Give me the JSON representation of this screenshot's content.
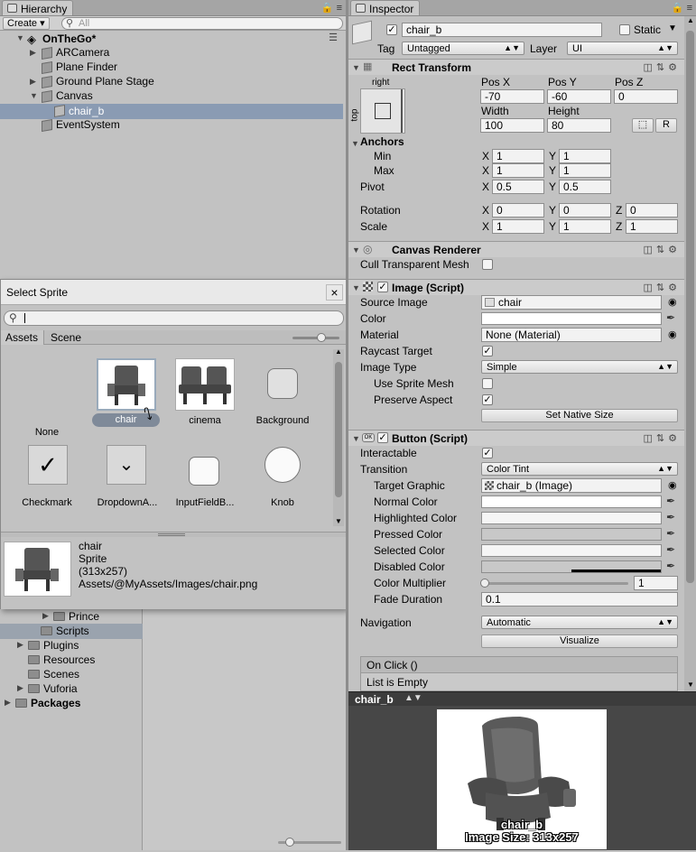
{
  "hierarchy": {
    "tab_label": "Hierarchy",
    "create_label": "Create",
    "search_placeholder": "All",
    "scene_name": "OnTheGo*",
    "items": [
      {
        "label": "ARCamera"
      },
      {
        "label": "Plane Finder"
      },
      {
        "label": "Ground Plane Stage"
      },
      {
        "label": "Canvas"
      },
      {
        "label": "chair_b"
      },
      {
        "label": "EventSystem"
      }
    ]
  },
  "project": {
    "items": [
      {
        "label": "Prince"
      },
      {
        "label": "Scripts"
      },
      {
        "label": "Plugins"
      },
      {
        "label": "Resources"
      },
      {
        "label": "Scenes"
      },
      {
        "label": "Vuforia"
      },
      {
        "label": "Packages"
      }
    ]
  },
  "select_sprite": {
    "title": "Select Sprite",
    "close_label": "×",
    "tabs": [
      "Assets",
      "Scene"
    ],
    "items": [
      {
        "label": "None"
      },
      {
        "label": "chair"
      },
      {
        "label": "cinema"
      },
      {
        "label": "Background"
      },
      {
        "label": "Checkmark"
      },
      {
        "label": "DropdownA..."
      },
      {
        "label": "InputFieldB..."
      },
      {
        "label": "Knob"
      }
    ],
    "info": {
      "name": "chair",
      "type": "Sprite",
      "size": "(313x257)",
      "path": "Assets/@MyAssets/Images/chair.png"
    }
  },
  "inspector": {
    "tab_label": "Inspector",
    "object_name": "chair_b",
    "static_label": "Static",
    "tag_label": "Tag",
    "tag_value": "Untagged",
    "layer_label": "Layer",
    "layer_value": "UI",
    "rect_transform": {
      "title": "Rect Transform",
      "anchor_h": "right",
      "anchor_v": "top",
      "pos_x_label": "Pos X",
      "pos_y_label": "Pos Y",
      "pos_z_label": "Pos Z",
      "pos_x": "-70",
      "pos_y": "-60",
      "pos_z": "0",
      "width_label": "Width",
      "height_label": "Height",
      "width": "100",
      "height": "80",
      "r_label": "R",
      "anchors_label": "Anchors",
      "min_label": "Min",
      "max_label": "Max",
      "min_x": "1",
      "min_y": "1",
      "max_x": "1",
      "max_y": "1",
      "pivot_label": "Pivot",
      "pivot_x": "0.5",
      "pivot_y": "0.5",
      "rotation_label": "Rotation",
      "rot_x": "0",
      "rot_y": "0",
      "rot_z": "0",
      "scale_label": "Scale",
      "scale_x": "1",
      "scale_y": "1",
      "scale_z": "1",
      "x": "X",
      "y": "Y",
      "z": "Z"
    },
    "canvas_renderer": {
      "title": "Canvas Renderer",
      "cull_label": "Cull Transparent Mesh"
    },
    "image": {
      "title": "Image (Script)",
      "source_label": "Source Image",
      "source_value": "chair",
      "color_label": "Color",
      "material_label": "Material",
      "material_value": "None (Material)",
      "raycast_label": "Raycast Target",
      "image_type_label": "Image Type",
      "image_type_value": "Simple",
      "sprite_mesh_label": "Use Sprite Mesh",
      "preserve_label": "Preserve Aspect",
      "native_size_label": "Set Native Size"
    },
    "button": {
      "title": "Button (Script)",
      "interactable_label": "Interactable",
      "transition_label": "Transition",
      "transition_value": "Color Tint",
      "target_label": "Target Graphic",
      "target_value": "chair_b (Image)",
      "normal_label": "Normal Color",
      "highlighted_label": "Highlighted Color",
      "pressed_label": "Pressed Color",
      "selected_label": "Selected Color",
      "disabled_label": "Disabled Color",
      "multiplier_label": "Color Multiplier",
      "multiplier_value": "1",
      "fade_label": "Fade Duration",
      "fade_value": "0.1",
      "navigation_label": "Navigation",
      "navigation_value": "Automatic",
      "visualize_label": "Visualize",
      "onclick_label": "On Click ()",
      "list_empty_label": "List is Empty"
    },
    "preview": {
      "tab_label": "chair_b",
      "caption_name": "chair_b",
      "caption_size": "Image Size: 313x257"
    }
  },
  "colors": {
    "selection": "#8a9bb3",
    "panel": "#c2c2c2",
    "preview_bg": "#474747"
  }
}
